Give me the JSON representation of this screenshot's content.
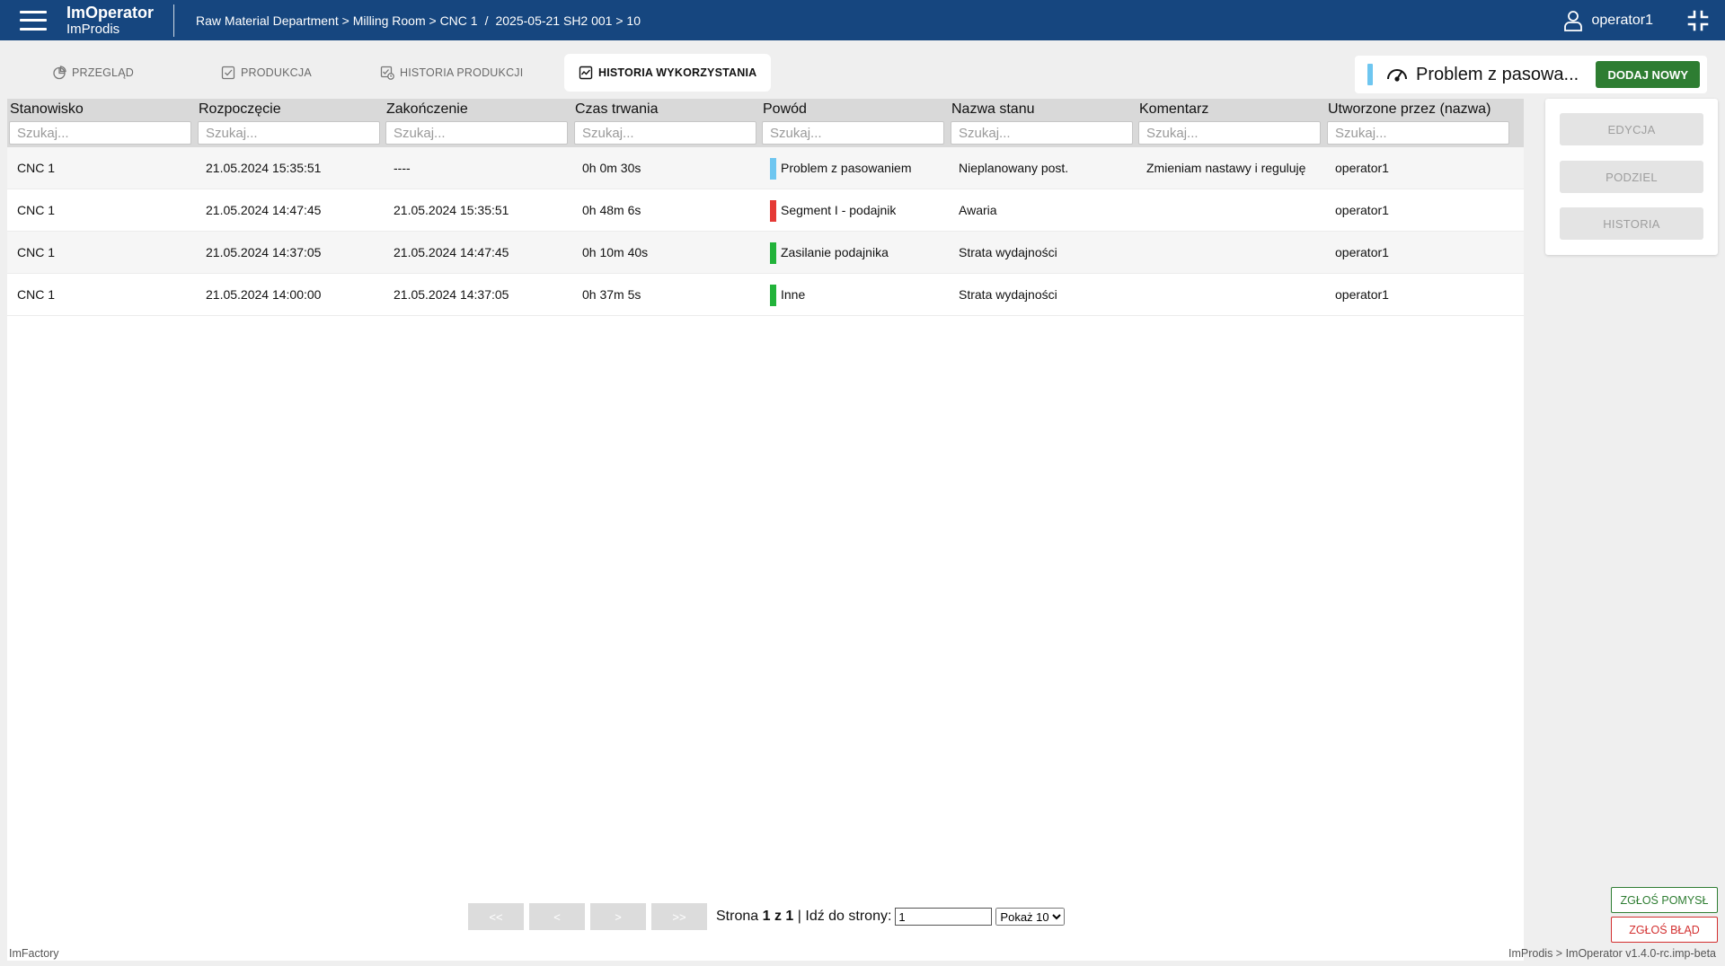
{
  "header": {
    "app_name": "ImOperator",
    "company": "ImProdis",
    "breadcrumb_path": "Raw Material Department > Milling Room > CNC 1",
    "breadcrumb_separator": "/",
    "breadcrumb_shift": "2025-05-21 SH2 001 > 10",
    "username": "operator1",
    "bar_color": "#16467f"
  },
  "tabs": [
    {
      "label": "PRZEGLĄD",
      "icon": "pie-chart-icon",
      "active": false
    },
    {
      "label": "PRODUKCJA",
      "icon": "checkbox-icon",
      "active": false
    },
    {
      "label": "HISTORIA PRODUKCJI",
      "icon": "history-checklist-icon",
      "active": false
    },
    {
      "label": "HISTORIA WYKORZYSTANIA",
      "icon": "usage-chart-icon",
      "active": true
    }
  ],
  "current_state": {
    "text": "Problem z pasowa...",
    "color": "#6ec6f0",
    "icon": "speedometer-icon",
    "add_button": "DODAJ NOWY"
  },
  "table": {
    "columns": [
      {
        "label": "Stanowisko",
        "placeholder": "Szukaj..."
      },
      {
        "label": "Rozpoczęcie",
        "placeholder": "Szukaj..."
      },
      {
        "label": "Zakończenie",
        "placeholder": "Szukaj..."
      },
      {
        "label": "Czas trwania",
        "placeholder": "Szukaj..."
      },
      {
        "label": "Powód",
        "placeholder": "Szukaj..."
      },
      {
        "label": "Nazwa stanu",
        "placeholder": "Szukaj..."
      },
      {
        "label": "Komentarz",
        "placeholder": "Szukaj..."
      },
      {
        "label": "Utworzone przez (nazwa)",
        "placeholder": "Szukaj..."
      }
    ],
    "rows": [
      {
        "station": "CNC 1",
        "start": "21.05.2024 15:35:51",
        "end": "----",
        "duration": "0h 0m 30s",
        "reason": "Problem z pasowaniem",
        "reason_color": "#6ec6f0",
        "state": "Nieplanowany post.",
        "comment": "Zmieniam nastawy i reguluję",
        "created_by": "operator1"
      },
      {
        "station": "CNC 1",
        "start": "21.05.2024 14:47:45",
        "end": "21.05.2024 15:35:51",
        "duration": "0h 48m 6s",
        "reason": "Segment I - podajnik",
        "reason_color": "#e53935",
        "state": "Awaria",
        "comment": "",
        "created_by": "operator1"
      },
      {
        "station": "CNC 1",
        "start": "21.05.2024 14:37:05",
        "end": "21.05.2024 14:47:45",
        "duration": "0h 10m 40s",
        "reason": "Zasilanie podajnika",
        "reason_color": "#22b33a",
        "state": "Strata wydajności",
        "comment": "",
        "created_by": "operator1"
      },
      {
        "station": "CNC 1",
        "start": "21.05.2024 14:00:00",
        "end": "21.05.2024 14:37:05",
        "duration": "0h 37m 5s",
        "reason": "Inne",
        "reason_color": "#22b33a",
        "state": "Strata wydajności",
        "comment": "",
        "created_by": "operator1"
      }
    ]
  },
  "pagination": {
    "first": "<<",
    "prev": "<",
    "next": ">",
    "last": ">>",
    "page_label": "Strona",
    "current_page": "1",
    "of_label": "z",
    "total_pages": "1",
    "goto_label": "| Idź do strony:",
    "goto_value": "1",
    "page_size_label": "Pokaż 10"
  },
  "actions": {
    "edit": "EDYCJA",
    "split": "PODZIEL",
    "history": "HISTORIA"
  },
  "feedback": {
    "idea": "ZGŁOŚ POMYSŁ",
    "bug": "ZGŁOŚ BŁĄD"
  },
  "footer": {
    "left": "ImFactory",
    "right": "ImProdis > ImOperator v1.4.0-rc.imp-beta"
  }
}
